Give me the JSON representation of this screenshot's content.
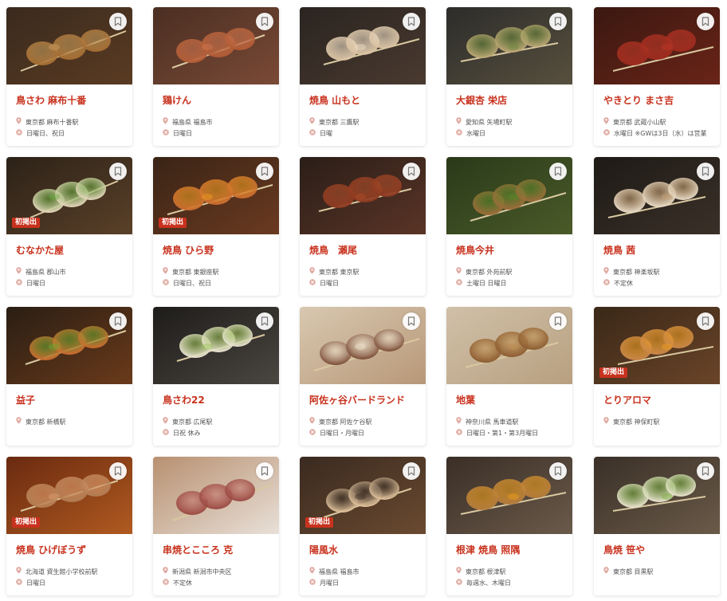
{
  "labels": {
    "badge": "初掲出"
  },
  "colors": {
    "accent": "#c8321e",
    "text": "#555555",
    "icon": "#e0a9a0"
  },
  "icons": {
    "bookmark": "bookmark-icon",
    "location": "location-pin-icon",
    "holiday": "calendar-closed-icon"
  },
  "restaurants": [
    {
      "name": "鳥さわ 麻布十番",
      "location": "東京都 麻布十番駅",
      "holiday": "日曜日、祝日",
      "badge": false,
      "photo": {
        "bg": "#3a2a1e",
        "mid": "#5a3b22",
        "meat": "#a36a30",
        "accent": "#c9a060"
      }
    },
    {
      "name": "鶏けん",
      "location": "福島県 福島市",
      "holiday": "日曜日",
      "badge": false,
      "photo": {
        "bg": "#4a2e22",
        "mid": "#7a4a36",
        "meat": "#b05a34",
        "accent": "#d07850"
      }
    },
    {
      "name": "焼鳥 山もと",
      "location": "東京都 三鷹駅",
      "holiday": "日曜",
      "badge": false,
      "photo": {
        "bg": "#2a2420",
        "mid": "#4a3a30",
        "meat": "#d8c0a0",
        "accent": "#f0e0c8"
      }
    },
    {
      "name": "大銀杏 栄店",
      "location": "愛知県 矢場町駅",
      "holiday": "水曜日",
      "badge": false,
      "photo": {
        "bg": "#2c2c2a",
        "mid": "#58503e",
        "meat": "#c0a878",
        "accent": "#6a8a3a"
      }
    },
    {
      "name": "やきとり まさ吉",
      "location": "東京都 武蔵小山駅",
      "holiday": "水曜日 ※GWは3日（水）は営業",
      "badge": false,
      "photo": {
        "bg": "#3a1810",
        "mid": "#6a2418",
        "meat": "#9a2a1e",
        "accent": "#c03a28"
      }
    },
    {
      "name": "むなかた屋",
      "location": "福島県 郡山市",
      "holiday": "日曜日",
      "badge": true,
      "photo": {
        "bg": "#2c2218",
        "mid": "#5a4028",
        "meat": "#e8d8c0",
        "accent": "#6aaa40"
      }
    },
    {
      "name": "焼鳥 ひら野",
      "location": "東京都 東銀座駅",
      "holiday": "日曜日、祝日",
      "badge": true,
      "photo": {
        "bg": "#3a2416",
        "mid": "#6a3a20",
        "meat": "#c86a30",
        "accent": "#f0a020"
      }
    },
    {
      "name": "焼鳥　瀬尾",
      "location": "東京都 東京駅",
      "holiday": "日曜日",
      "badge": false,
      "photo": {
        "bg": "#2a1e18",
        "mid": "#5a3426",
        "meat": "#8a3820",
        "accent": "#b0502a"
      }
    },
    {
      "name": "焼鳥今井",
      "location": "東京都 外苑前駅",
      "holiday": "土曜日 日曜日",
      "badge": false,
      "photo": {
        "bg": "#2a3a1a",
        "mid": "#4a5a28",
        "meat": "#a06a3a",
        "accent": "#5a8a2a"
      }
    },
    {
      "name": "焼鳥 茜",
      "location": "東京都 神楽坂駅",
      "holiday": "不定休",
      "badge": false,
      "photo": {
        "bg": "#1e1a16",
        "mid": "#3a3028",
        "meat": "#e8dcc8",
        "accent": "#c8a070"
      }
    },
    {
      "name": "益子",
      "location": "東京都 新橋駅",
      "holiday": "",
      "badge": false,
      "photo": {
        "bg": "#2a1e14",
        "mid": "#6a3a1a",
        "meat": "#d06a30",
        "accent": "#6aaa30"
      }
    },
    {
      "name": "鳥さわ22",
      "location": "東京都 広尾駅",
      "holiday": "日祝 休み",
      "badge": false,
      "photo": {
        "bg": "#1e1c1a",
        "mid": "#4a4640",
        "meat": "#ece4d8",
        "accent": "#9ac050"
      }
    },
    {
      "name": "阿佐ヶ谷バードランド",
      "location": "東京都 阿佐ケ谷駅",
      "holiday": "日曜日・月曜日",
      "badge": false,
      "photo": {
        "bg": "#d8c8b0",
        "mid": "#b89878",
        "meat": "#7a4a34",
        "accent": "#f0e4d0"
      }
    },
    {
      "name": "地葉",
      "location": "神奈川県 馬車道駅",
      "holiday": "日曜日・第1・第3月曜日",
      "badge": false,
      "photo": {
        "bg": "#d0c0a8",
        "mid": "#b8a080",
        "meat": "#8a5a30",
        "accent": "#c09050"
      }
    },
    {
      "name": "とりアロマ",
      "location": "東京都 神保町駅",
      "holiday": "",
      "badge": true,
      "photo": {
        "bg": "#3a2818",
        "mid": "#6a4428",
        "meat": "#c8864a",
        "accent": "#f0a020"
      }
    },
    {
      "name": "焼鳥 ひげぼうず",
      "location": "北海道 資生館小学校前駅",
      "holiday": "日曜日",
      "badge": true,
      "photo": {
        "bg": "#6a2a10",
        "mid": "#b05a20",
        "meat": "#b07a50",
        "accent": "#e0a070"
      }
    },
    {
      "name": "串焼とこころ 克",
      "location": "新潟県 新潟市中央区",
      "holiday": "不定休",
      "badge": false,
      "photo": {
        "bg": "#b89070",
        "mid": "#e8e0d8",
        "meat": "#9a4a42",
        "accent": "#c07068"
      }
    },
    {
      "name": "陽風水",
      "location": "福島県 福島市",
      "holiday": "月曜日",
      "badge": true,
      "photo": {
        "bg": "#3a2a20",
        "mid": "#6a4a30",
        "meat": "#e8c8a0",
        "accent": "#3a3028"
      }
    },
    {
      "name": "根津 焼鳥 照隅",
      "location": "東京都 根津駅",
      "holiday": "毎週水、木曜日",
      "badge": false,
      "photo": {
        "bg": "#3a2e26",
        "mid": "#6a5a4a",
        "meat": "#b07a40",
        "accent": "#f0a018"
      }
    },
    {
      "name": "鳥焼 笹や",
      "location": "東京都 目黒駅",
      "holiday": "",
      "badge": false,
      "photo": {
        "bg": "#3a3028",
        "mid": "#6a5a48",
        "meat": "#ece4d4",
        "accent": "#7ab040"
      }
    }
  ]
}
